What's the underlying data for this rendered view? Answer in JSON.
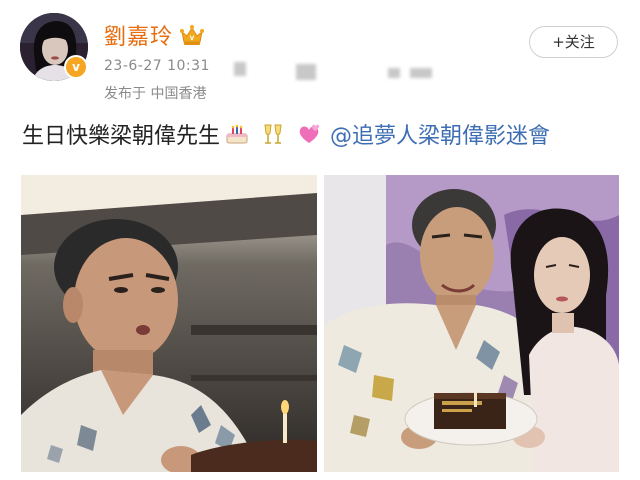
{
  "user": {
    "name": "劉嘉玲",
    "badge_icon": "crown-icon",
    "verified_icon": "vip-badge-icon",
    "verified_mark": "v"
  },
  "post": {
    "timestamp": "23-6-27 10:31",
    "source": "发布于 中国香港",
    "text": "生日快樂梁朝偉先生",
    "emojis": [
      "birthday-cake-icon",
      "champagne-glasses-icon",
      "pink-hearts-icon"
    ],
    "mention": "@追夢人梁朝偉影迷會"
  },
  "actions": {
    "follow_label": "+关注"
  },
  "images": [
    {
      "name": "photo-man-birthday-cake"
    },
    {
      "name": "photo-couple-with-cake"
    }
  ],
  "colors": {
    "username": "#e86b0c",
    "mention": "#3d6eb3",
    "meta": "#8a8a8a",
    "badge": "#f6a623"
  }
}
